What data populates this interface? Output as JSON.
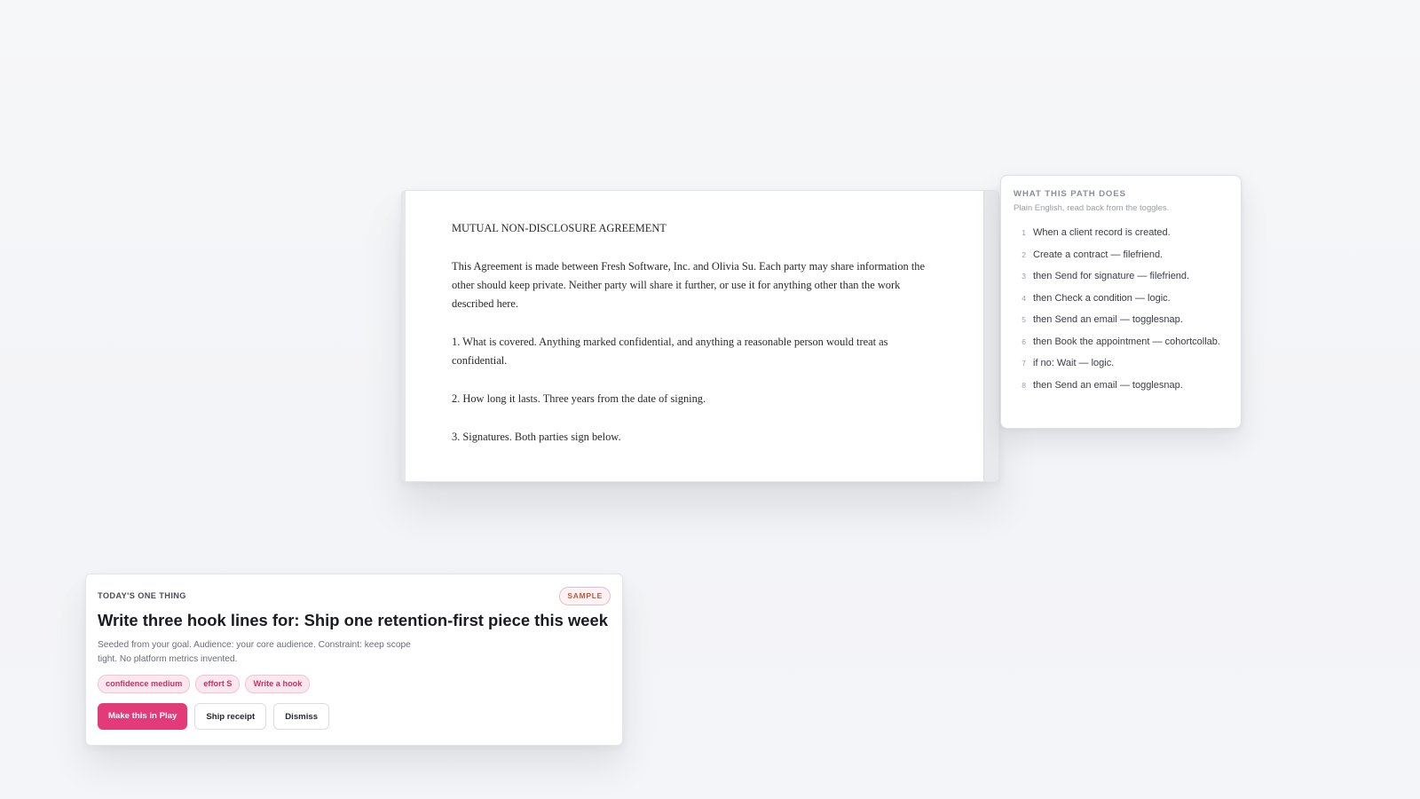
{
  "document": {
    "title": "MUTUAL NON-DISCLOSURE AGREEMENT",
    "intro": "This Agreement is made between Fresh Software, Inc. and Olivia Su. Each party may share information the other should keep private. Neither party will share it further, or use it for anything other than the work described here.",
    "clause_1": "1. What is covered. Anything marked confidential, and anything a reasonable person would treat as confidential.",
    "clause_2": "2. How long it lasts. Three years from the date of signing.",
    "clause_3": "3. Signatures. Both parties sign below."
  },
  "path_panel": {
    "title": "WHAT THIS PATH DOES",
    "subtitle": "Plain English, read back from the toggles.",
    "steps": [
      {
        "num": "1",
        "text": "When a client record is created."
      },
      {
        "num": "2",
        "text": "Create a contract — filefriend."
      },
      {
        "num": "3",
        "text": "then Send for signature — filefriend."
      },
      {
        "num": "4",
        "text": "then Check a condition — logic."
      },
      {
        "num": "5",
        "text": "then Send an email — togglesnap."
      },
      {
        "num": "6",
        "text": "then Book the appointment — cohortcollab."
      },
      {
        "num": "7",
        "text": "if no: Wait — logic."
      },
      {
        "num": "8",
        "text": "then Send an email — togglesnap."
      }
    ]
  },
  "today_card": {
    "eyebrow": "TODAY'S ONE THING",
    "badge": "SAMPLE",
    "headline": "Write three hook lines for: Ship one retention-first piece this week",
    "description": "Seeded from your goal. Audience: your core audience. Constraint: keep scope tight. No platform metrics invented.",
    "chips": [
      "confidence medium",
      "effort S",
      "Write a hook"
    ],
    "primary_button": "Make this in Play",
    "secondary_button": "Ship receipt",
    "dismiss_button": "Dismiss"
  },
  "colors": {
    "accent": "#e33b79",
    "chip_bg": "#fbe7ee",
    "badge_text": "#c0573b"
  }
}
